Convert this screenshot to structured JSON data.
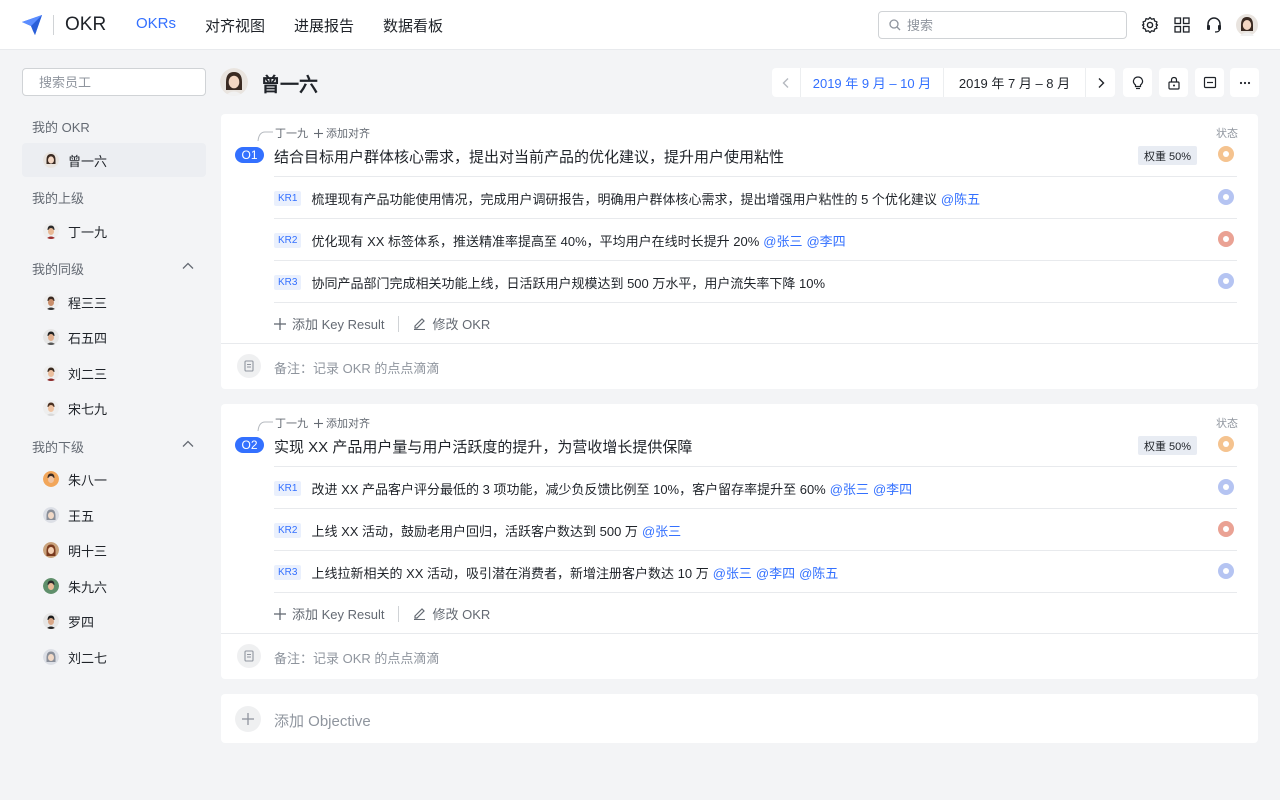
{
  "app": {
    "name": "OKR"
  },
  "nav": {
    "items": [
      "OKRs",
      "对齐视图",
      "进展报告",
      "数据看板"
    ],
    "active": 0
  },
  "top_search": {
    "placeholder": "搜索"
  },
  "sidebar": {
    "search_placeholder": "搜索员工",
    "sections": {
      "mine": {
        "title": "我的 OKR",
        "people": [
          "曾一六"
        ]
      },
      "superior": {
        "title": "我的上级",
        "people": [
          "丁一九"
        ]
      },
      "peers": {
        "title": "我的同级",
        "people": [
          "程三三",
          "石五四",
          "刘二三",
          "宋七九"
        ]
      },
      "subordinates": {
        "title": "我的下级",
        "people": [
          "朱八一",
          "王五",
          "明十三",
          "朱九六",
          "罗四",
          "刘二七"
        ]
      }
    }
  },
  "header": {
    "user_name": "曾一六",
    "period_current": "2019 年 9 月 – 10 月",
    "period_other": "2019 年 7 月 – 8 月"
  },
  "colors": {
    "accent": "#3370ff",
    "status_orange": "#f5c38f",
    "status_blue": "#b5c4f2",
    "status_red": "#eaa294"
  },
  "objectives": [
    {
      "label": "O1",
      "aligned_to": "丁一九",
      "add_align": "添加对齐",
      "title": "结合目标用户群体核心需求，提出对当前产品的优化建议，提升用户使用粘性",
      "weight": "权重 50%",
      "status_label": "状态",
      "key_results": [
        {
          "tag": "KR1",
          "text": "梳理现有产品功能使用情况，完成用户调研报告，明确用户群体核心需求，提出增强用户粘性的 5 个优化建议",
          "mentions": [
            "@陈五"
          ]
        },
        {
          "tag": "KR2",
          "text": "优化现有 XX 标签体系，推送精准率提高至 40%，平均用户在线时长提升 20%",
          "mentions": [
            "@张三",
            "@李四"
          ]
        },
        {
          "tag": "KR3",
          "text": "协同产品部门完成相关功能上线，日活跃用户规模达到 500 万水平，用户流失率下降 10%",
          "mentions": []
        }
      ],
      "add_kr": "添加 Key Result",
      "edit_okr": "修改 OKR",
      "note": "备注：记录 OKR 的点点滴滴"
    },
    {
      "label": "O2",
      "aligned_to": "丁一九",
      "add_align": "添加对齐",
      "title": "实现 XX 产品用户量与用户活跃度的提升，为营收增长提供保障",
      "weight": "权重 50%",
      "status_label": "状态",
      "key_results": [
        {
          "tag": "KR1",
          "text": "改进 XX 产品客户评分最低的 3 项功能，减少负反馈比例至 10%，客户留存率提升至 60%",
          "mentions": [
            "@张三",
            "@李四"
          ]
        },
        {
          "tag": "KR2",
          "text": "上线 XX 活动，鼓励老用户回归，活跃客户数达到 500 万",
          "mentions": [
            "@张三"
          ]
        },
        {
          "tag": "KR3",
          "text": "上线拉新相关的 XX 活动，吸引潜在消费者，新增注册客户数达 10 万",
          "mentions": [
            "@张三",
            "@李四",
            "@陈五"
          ]
        }
      ],
      "add_kr": "添加 Key Result",
      "edit_okr": "修改 OKR",
      "note": "备注：记录 OKR 的点点滴滴"
    }
  ],
  "add_objective": "添加 Objective"
}
